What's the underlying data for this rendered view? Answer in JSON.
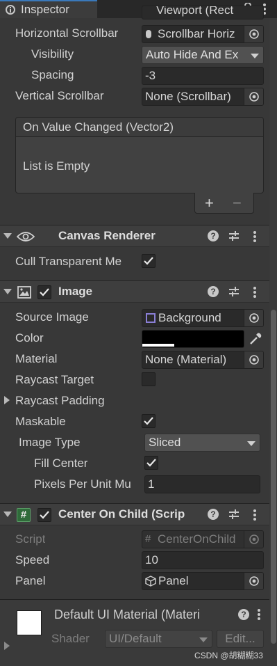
{
  "window": {
    "tab_title": "Inspector",
    "icons": [
      "inspector-icon",
      "lock-icon",
      "kebab-menu-icon"
    ]
  },
  "scroll_rect": {
    "viewport_value": "Viewport (Rect",
    "horizontal_scrollbar_label": "Horizontal Scrollbar",
    "horizontal_scrollbar_value": "Scrollbar Horiz",
    "visibility_label": "Visibility",
    "visibility_value": "Auto Hide And Ex",
    "spacing_label": "Spacing",
    "spacing_value": "-3",
    "vertical_scrollbar_label": "Vertical Scrollbar",
    "vertical_scrollbar_value": "None (Scrollbar)",
    "event_title": "On Value Changed (Vector2)",
    "event_empty": "List is Empty",
    "add_label": "+",
    "remove_label": "−"
  },
  "canvas_renderer": {
    "title": "Canvas Renderer",
    "cull_label": "Cull Transparent Me",
    "cull_checked": true
  },
  "image": {
    "title": "Image",
    "enabled": true,
    "source_image_label": "Source Image",
    "source_image_value": "Background",
    "color_label": "Color",
    "color_value": "#000000",
    "material_label": "Material",
    "material_value": "None (Material)",
    "raycast_target_label": "Raycast Target",
    "raycast_target_checked": false,
    "raycast_padding_label": "Raycast Padding",
    "maskable_label": "Maskable",
    "maskable_checked": true,
    "image_type_label": "Image Type",
    "image_type_value": "Sliced",
    "fill_center_label": "Fill Center",
    "fill_center_checked": true,
    "ppu_label": "Pixels Per Unit Mu",
    "ppu_value": "1"
  },
  "center_on_child": {
    "title": "Center On Child (Scrip",
    "enabled": true,
    "script_label": "Script",
    "script_value": "CenterOnChild",
    "speed_label": "Speed",
    "speed_value": "10",
    "panel_label": "Panel",
    "panel_value": "Panel"
  },
  "material_preview": {
    "title": "Default UI Material (Materi",
    "shader_label": "Shader",
    "shader_value": "UI/Default",
    "edit_label": "Edit..."
  },
  "watermark": "CSDN @胡糊糊33",
  "colors": {
    "background": "#383838",
    "header": "#3e3e3e",
    "field": "#2a2a2a",
    "accent_tab": "#3a79bb"
  }
}
